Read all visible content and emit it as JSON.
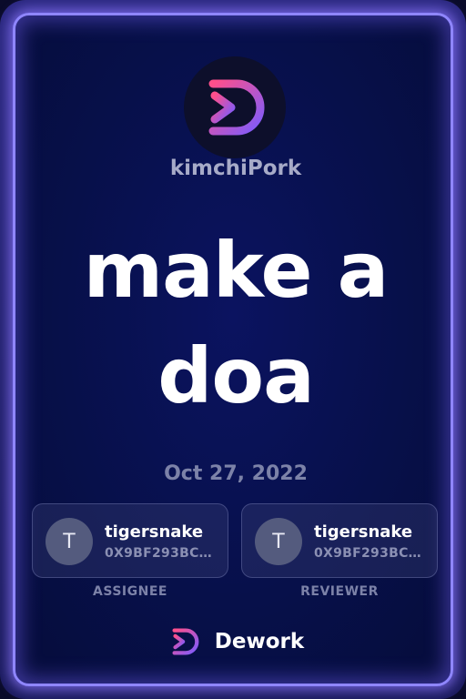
{
  "organization": {
    "name": "kimchiPork",
    "logo_icon": "dework-logo-icon"
  },
  "task": {
    "title_line1": "make a",
    "title_line2": "doa",
    "date": "Oct 27, 2022"
  },
  "assignee": {
    "avatar_initial": "T",
    "name": "tigersnake",
    "address": "0X9BF293BC…",
    "role_label": "ASSIGNEE"
  },
  "reviewer": {
    "avatar_initial": "T",
    "name": "tigersnake",
    "address": "0X9BF293BC…",
    "role_label": "REVIEWER"
  },
  "footer": {
    "brand": "Dework",
    "logo_icon": "dework-logo-icon"
  },
  "colors": {
    "accent_gradient_start": "#ff4f8b",
    "accent_gradient_end": "#7b5cff",
    "border_glow": "#8f86ff",
    "background": "#07104a"
  }
}
